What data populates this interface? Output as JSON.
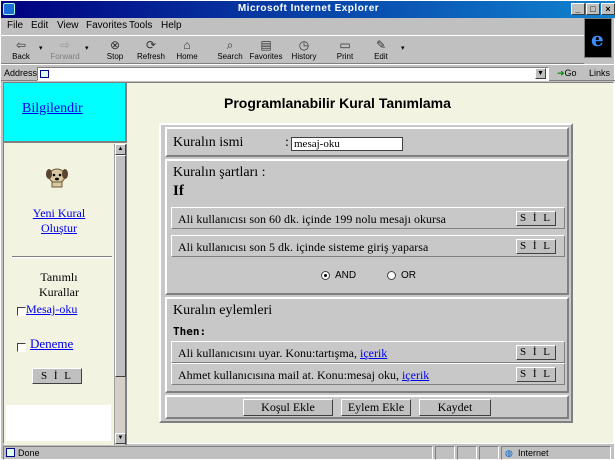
{
  "window": {
    "title": "Microsoft Internet Explorer"
  },
  "menu": [
    "File",
    "Edit",
    "View",
    "Favorites",
    "Tools",
    "Help"
  ],
  "toolbar": {
    "back": "Back",
    "forward": "Forward",
    "stop": "Stop",
    "refresh": "Refresh",
    "home": "Home",
    "search": "Search",
    "favorites": "Favorites",
    "history": "History",
    "print": "Print",
    "edit": "Edit"
  },
  "address": {
    "label": "Address",
    "value": "",
    "go": "Go",
    "links": "Links"
  },
  "left": {
    "top_link": "Bilgilendir",
    "new_rule_line1": "Yeni Kural",
    "new_rule_line2": "Oluştur",
    "defined_line1": "Tanımlı",
    "defined_line2": "Kurallar",
    "rules": [
      "Mesaj-oku",
      "Deneme"
    ],
    "delete_button": "S İ L"
  },
  "main": {
    "heading": "Programlanabilir Kural Tanımlama",
    "name_label": "Kuralın ismi",
    "name_colon": ":",
    "name_value": "mesaj-oku",
    "conditions_label": "Kuralın şartları :",
    "if_label": "If",
    "conditions": [
      {
        "text": "Ali kullanıcısı son 60 dk. içinde 199 nolu mesajı okursa",
        "button": "S İ L"
      },
      {
        "text": "Ali kullanıcısı son 5 dk. içinde sisteme giriş yaparsa",
        "button": "S İ L"
      }
    ],
    "operator_and": "AND",
    "operator_or": "OR",
    "operator_selected": "AND",
    "actions_label": "Kuralın eylemleri",
    "then_label": "Then:",
    "actions": [
      {
        "text": "Ali kullanıcısını uyar. Konu:tartışma,",
        "link": "içerik",
        "button": "S İ L"
      },
      {
        "text": "Ahmet kullanıcısına mail at. Konu:mesaj oku,",
        "link": "içerik",
        "button": "S İ L"
      }
    ],
    "buttons": {
      "add_condition": "Koşul Ekle",
      "add_action": "Eylem Ekle",
      "save": "Kaydet"
    }
  },
  "status": {
    "left": "Done",
    "zone": "Internet"
  }
}
